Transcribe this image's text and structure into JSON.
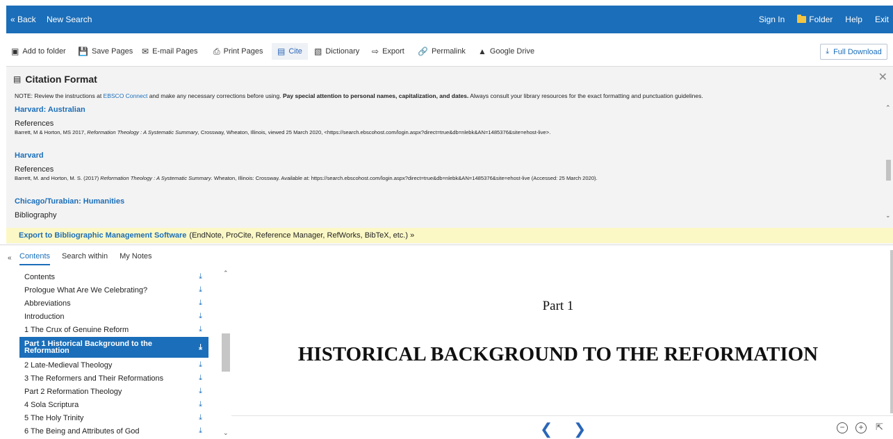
{
  "topbar": {
    "back": "« Back",
    "new_search": "New Search",
    "sign_in": "Sign In",
    "folder": "Folder",
    "help": "Help",
    "exit": "Exit"
  },
  "toolbar": {
    "add_to_folder": "Add to folder",
    "save_pages": "Save Pages",
    "email_pages": "E-mail Pages",
    "print_pages": "Print Pages",
    "cite": "Cite",
    "dictionary": "Dictionary",
    "export": "Export",
    "permalink": "Permalink",
    "google_drive": "Google Drive",
    "full_download": "Full Download"
  },
  "citation": {
    "title": "Citation Format",
    "note_prefix": "NOTE: Review the instructions at ",
    "note_link": "EBSCO Connect",
    "note_mid": " and make any necessary corrections before using. ",
    "note_bold": "Pay special attention to personal names, capitalization, and dates.",
    "note_suffix": " Always consult your library resources for the exact formatting and punctuation guidelines.",
    "formats": [
      {
        "name": "Harvard: Australian",
        "section": "References",
        "pre": "Barrett, M & Horton, MS 2017, ",
        "title": "Reformation Theology : A Systematic Summary",
        "post": ", Crossway, Wheaton, Illinois, viewed 25 March 2020, <https://search.ebscohost.com/login.aspx?direct=true&db=nlebk&AN=1485376&site=ehost-live>."
      },
      {
        "name": "Harvard",
        "section": "References",
        "pre": "Barrett, M. and Horton, M. S. (2017) ",
        "title": "Reformation Theology : A Systematic Summary",
        "post": ". Wheaton, Illinois: Crossway. Available at: https://search.ebscohost.com/login.aspx?direct=true&db=nlebk&AN=1485376&site=ehost-live (Accessed: 25 March 2020)."
      },
      {
        "name": "Chicago/Turabian: Humanities",
        "section": "Bibliography"
      }
    ],
    "export_link": "Export to Bibliographic Management Software",
    "export_rest": "(EndNote, ProCite, Reference Manager, RefWorks, BibTeX, etc.) »"
  },
  "sidebar": {
    "tabs": [
      "Contents",
      "Search within",
      "My Notes"
    ],
    "active_tab": "Contents",
    "toc": [
      "Contents",
      "Prologue What Are We Celebrating?",
      "Abbreviations",
      "Introduction",
      "1 The Crux of Genuine Reform",
      "Part 1 Historical Background to the Reformation",
      "2 Late-Medieval Theology",
      "3 The Reformers and Their Reformations",
      "Part 2 Reformation Theology",
      "4 Sola Scriptura",
      "5 The Holy Trinity",
      "6 The Being and Attributes of God"
    ],
    "selected_index": 5
  },
  "viewer": {
    "part": "Part 1",
    "title": "HISTORICAL BACKGROUND TO THE REFORMATION"
  }
}
